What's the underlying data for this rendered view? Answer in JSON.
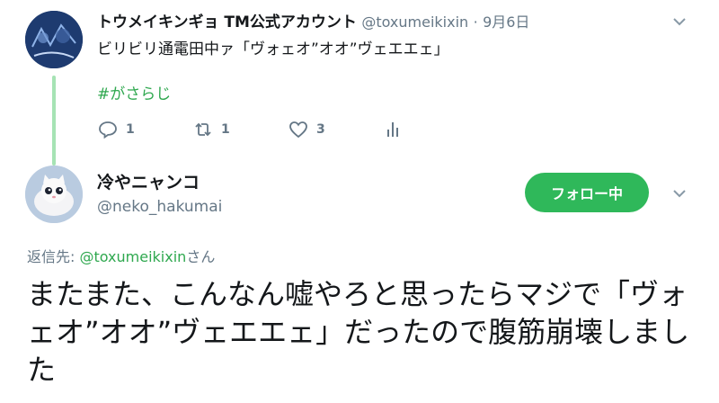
{
  "parent_tweet": {
    "display_name": "トウメイキンギョ TM公式アカウント",
    "handle": "@toxumeikixin",
    "separator": "·",
    "date": "9月6日",
    "text": "ビリビリ通電田中ァ「ヴォェオ”オオ”ヴェエエェ」",
    "hashtag": "#がさらじ",
    "actions": {
      "reply_count": "1",
      "retweet_count": "1",
      "like_count": "3"
    }
  },
  "reply_tweet": {
    "display_name": "冷やニャンコ",
    "handle": "@neko_hakumai",
    "follow_label": "フォロー中",
    "reply_to_prefix": "返信先: ",
    "reply_to_handle": "@toxumeikixin",
    "reply_to_suffix": "さん",
    "text": "またまた、こんなん嘘やろと思ったらマジで「ヴォェオ”オオ”ヴェエエェ」だったので腹筋崩壊しました"
  },
  "colors": {
    "accent_green": "#2fb85a",
    "hashtag_green": "#2fa84f",
    "thread_line": "#a6e3b4",
    "muted": "#657786"
  },
  "icons": [
    "reply-icon",
    "retweet-icon",
    "like-icon",
    "analytics-icon",
    "chevron-down-icon"
  ]
}
